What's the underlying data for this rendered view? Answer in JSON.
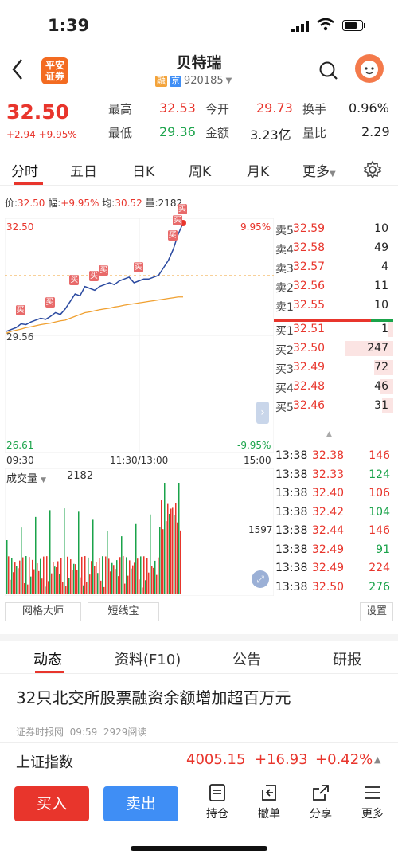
{
  "status": {
    "time": "1:39"
  },
  "header": {
    "back": "<",
    "logo_line1": "平安",
    "logo_line2": "证券",
    "title": "贝特瑞",
    "tag_rong": "融",
    "tag_jing": "京",
    "code": "920185",
    "colors": {
      "rong": "#f3a33a",
      "jing": "#3f8ef5"
    }
  },
  "quote": {
    "price": "32.50",
    "change": "+2.94 +9.95%",
    "high_label": "最高",
    "high": "32.53",
    "open_label": "今开",
    "open": "29.73",
    "turnover_label": "换手",
    "turnover": "0.96%",
    "low_label": "最低",
    "low": "29.36",
    "amount_label": "金额",
    "amount": "3.23亿",
    "volratio_label": "量比",
    "volratio": "2.29"
  },
  "tabs": {
    "t1": "分时",
    "t2": "五日",
    "t3": "日K",
    "t4": "周K",
    "t5": "月K",
    "more": "更多"
  },
  "infoline": {
    "p_label": "价:",
    "p": "32.50",
    "f_label": "幅:",
    "f": "+9.95%",
    "avg_label": "均:",
    "avg": "30.52",
    "vol_label": "量:",
    "vol": "2182"
  },
  "chart": {
    "top_price": "32.50",
    "top_pct": "9.95%",
    "mid_price": "29.56",
    "bottom_price": "26.61",
    "bottom_pct": "-9.95%",
    "t_start": "09:30",
    "t_mid": "11:30/13:00",
    "t_end": "15:00",
    "vol_label": "成交量",
    "vol_value": "2182",
    "vol_max": "1597",
    "buy_mark": "买",
    "price_line": [
      29.6,
      29.65,
      29.7,
      29.8,
      29.78,
      29.85,
      29.9,
      29.95,
      29.92,
      30.0,
      30.1,
      30.05,
      30.2,
      30.4,
      30.6,
      30.55,
      30.8,
      30.75,
      30.7,
      30.8,
      30.85,
      30.9,
      30.85,
      30.95,
      31.0,
      31.05,
      30.9,
      30.95,
      31.0,
      31.0,
      31.05,
      31.1,
      31.3,
      31.5,
      31.8,
      32.2,
      32.5
    ],
    "avg_line": [
      29.55,
      29.6,
      29.63,
      29.66,
      29.7,
      29.72,
      29.75,
      29.78,
      29.8,
      29.82,
      29.85,
      29.88,
      29.9,
      29.95,
      30.0,
      30.05,
      30.1,
      30.12,
      30.15,
      30.18,
      30.2,
      30.22,
      30.25,
      30.27,
      30.3,
      30.32,
      30.34,
      30.36,
      30.38,
      30.4,
      30.42,
      30.44,
      30.46,
      30.48,
      30.5,
      30.52,
      30.52
    ]
  },
  "book": {
    "sell": [
      {
        "l": "卖5",
        "p": "32.59",
        "v": "10"
      },
      {
        "l": "卖4",
        "p": "32.58",
        "v": "49"
      },
      {
        "l": "卖3",
        "p": "32.57",
        "v": "4"
      },
      {
        "l": "卖2",
        "p": "32.56",
        "v": "11"
      },
      {
        "l": "卖1",
        "p": "32.55",
        "v": "10"
      }
    ],
    "buy": [
      {
        "l": "买1",
        "p": "32.51",
        "v": "1"
      },
      {
        "l": "买2",
        "p": "32.50",
        "v": "247"
      },
      {
        "l": "买3",
        "p": "32.49",
        "v": "72"
      },
      {
        "l": "买4",
        "p": "32.48",
        "v": "46"
      },
      {
        "l": "买5",
        "p": "32.46",
        "v": "31"
      }
    ]
  },
  "ticks": [
    {
      "t": "13:38",
      "p": "32.38",
      "v": "146"
    },
    {
      "t": "13:38",
      "p": "32.33",
      "v": "124"
    },
    {
      "t": "13:38",
      "p": "32.40",
      "v": "106"
    },
    {
      "t": "13:38",
      "p": "32.42",
      "v": "104"
    },
    {
      "t": "13:38",
      "p": "32.44",
      "v": "146"
    },
    {
      "t": "13:38",
      "p": "32.49",
      "v": "91"
    },
    {
      "t": "13:38",
      "p": "32.49",
      "v": "224"
    },
    {
      "t": "13:38",
      "p": "32.50",
      "v": "276"
    }
  ],
  "tools": {
    "grid": "网格大师",
    "short": "短线宝",
    "settings": "设置"
  },
  "news": {
    "tab1": "动态",
    "tab2": "资料(F10)",
    "tab3": "公告",
    "tab4": "研报",
    "headline": "32只北交所股票融资余额增加超百万元",
    "source": "证券时报网",
    "time": "09:59",
    "reads": "2929阅读"
  },
  "index": {
    "name": "上证指数",
    "value": "4005.15",
    "change": "+16.93",
    "pct": "+0.42%"
  },
  "bottom": {
    "buy": "买入",
    "sell": "卖出",
    "hold": "持仓",
    "cancel": "撤单",
    "share": "分享",
    "more": "更多"
  }
}
